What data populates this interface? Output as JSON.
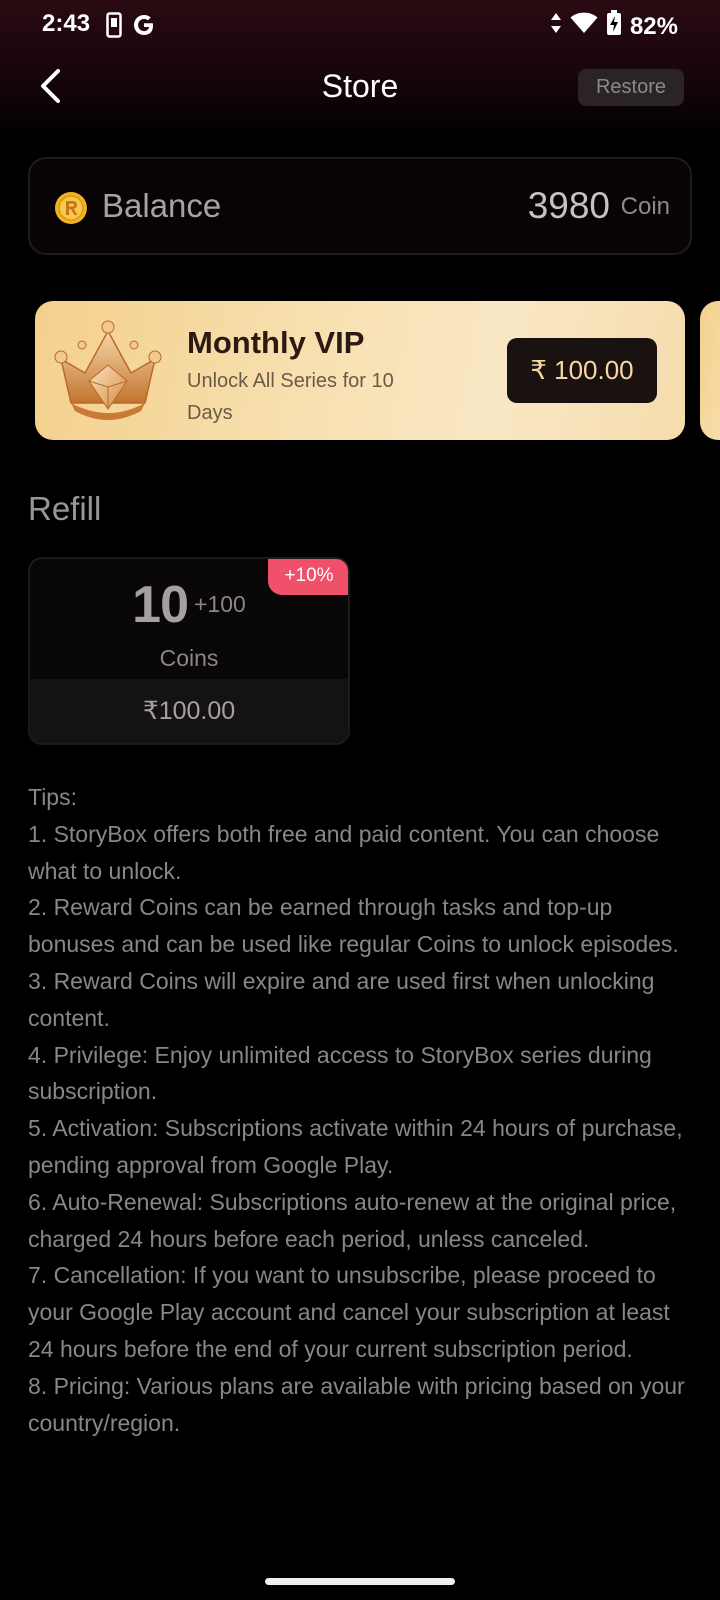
{
  "status_bar": {
    "time": "2:43",
    "battery": "82%"
  },
  "header": {
    "title": "Store",
    "restore_label": "Restore"
  },
  "balance": {
    "label": "Balance",
    "amount": "3980",
    "unit": "Coin"
  },
  "vip": {
    "title": "Monthly VIP",
    "subtitle": "Unlock All Series for 10 Days",
    "price": "₹ 100.00"
  },
  "refill": {
    "title": "Refill",
    "items": [
      {
        "amount": "10",
        "bonus": "+100",
        "unit": "Coins",
        "price": "₹100.00",
        "badge": "+10%"
      }
    ]
  },
  "tips": {
    "heading": "Tips:",
    "items": [
      "1. StoryBox offers both free and paid content. You can choose what to unlock.",
      "2. Reward Coins can be earned through tasks and top-up bonuses and can be used like regular Coins to unlock episodes.",
      "3. Reward Coins will expire and are used first when unlocking content.",
      "4. Privilege: Enjoy unlimited access to StoryBox series during subscription.",
      "5. Activation: Subscriptions activate within 24 hours of purchase, pending approval from Google Play.",
      "6. Auto-Renewal: Subscriptions auto-renew at the original price, charged 24 hours before each period, unless canceled.",
      "7. Cancellation: If you want to unsubscribe, please proceed to your Google Play account and cancel your subscription at least 24 hours before the end of your current subscription period.",
      "8. Pricing: Various plans are available with pricing based on your country/region."
    ]
  },
  "colors": {
    "accent_gold": "#f6d7a4",
    "badge_pink": "#f1506a",
    "background": "#000000"
  }
}
